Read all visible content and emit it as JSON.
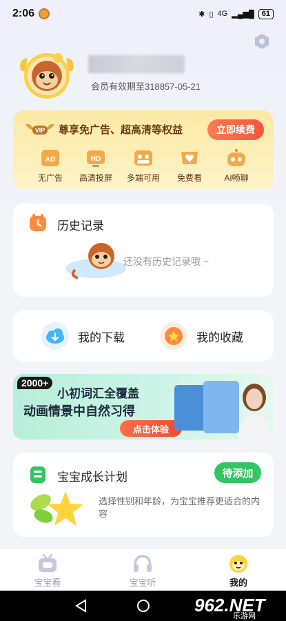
{
  "status_bar": {
    "time": "2:06",
    "network": "4G",
    "battery": "61"
  },
  "profile": {
    "member_expiry": "会员有效期至318857-05-21"
  },
  "vip": {
    "badge": "VIP",
    "title": "尊享免广告、超高清等权益",
    "renew_label": "立即续费",
    "perks": [
      {
        "label": "无广告",
        "icon": "ad-icon"
      },
      {
        "label": "高清投屏",
        "icon": "hd-icon"
      },
      {
        "label": "多端可用",
        "icon": "multi-device-icon"
      },
      {
        "label": "免费看",
        "icon": "free-watch-icon"
      },
      {
        "label": "AI畅聊",
        "icon": "ai-chat-icon"
      }
    ]
  },
  "history": {
    "title": "历史记录",
    "empty_text": "还没有历史记录哦 ~"
  },
  "shortcuts": {
    "downloads_label": "我的下载",
    "favorites_label": "我的收藏"
  },
  "banner": {
    "badge": "2000+",
    "line1": "小初词汇全覆盖",
    "line2": "动画情景中自然习得",
    "cta": "点击体验"
  },
  "growth": {
    "title": "宝宝成长计划",
    "add_label": "待添加",
    "description": "选择性别和年龄，为宝宝推荐更适合的内容"
  },
  "tabbar": {
    "tabs": [
      {
        "label": "宝宝看",
        "active": false
      },
      {
        "label": "宝宝听",
        "active": false
      },
      {
        "label": "我的",
        "active": true
      }
    ]
  },
  "watermark": {
    "text": "962.NET",
    "sub": "乐游网"
  },
  "colors": {
    "accent": "#f2563c",
    "vip_bg": "#fbe9a4",
    "green": "#33c463",
    "active_tab": "#222222",
    "inactive_tab": "#9aa0b4"
  }
}
